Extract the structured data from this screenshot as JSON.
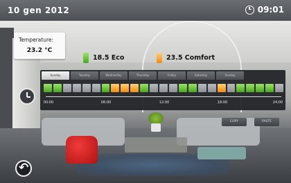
{
  "status_bar": {
    "date": "10 gen 2012",
    "time": "09:01",
    "clock_icon": "clock-icon"
  },
  "temperature": {
    "label": "Temperature:",
    "value": "23.2 °C"
  },
  "modes": {
    "eco": {
      "label": "18.5 Eco",
      "color": "#5cb82a"
    },
    "comfort": {
      "label": "23.5 Comfort",
      "color": "#f5a020"
    }
  },
  "schedule": {
    "days": [
      "Sunday",
      "Tuesday",
      "Wednesday",
      "Thursday",
      "Friday",
      "Saturday",
      "Sunday"
    ],
    "active_day_index": 0,
    "slots": [
      "eco",
      "eco",
      "off",
      "off",
      "off",
      "off",
      "eco",
      "comfort",
      "comfort",
      "comfort",
      "eco",
      "off",
      "off",
      "off",
      "eco",
      "eco",
      "off",
      "off",
      "comfort",
      "off",
      "eco",
      "eco",
      "eco",
      "eco",
      "off"
    ],
    "axis_labels": [
      "00:00",
      "06:00",
      "12:00",
      "18:00",
      "24:00"
    ]
  },
  "buttons": {
    "copy": "COPY",
    "paste": "PASTE"
  },
  "icons": {
    "schedule_clock": "clock-icon",
    "back": "back-arrow-icon"
  }
}
